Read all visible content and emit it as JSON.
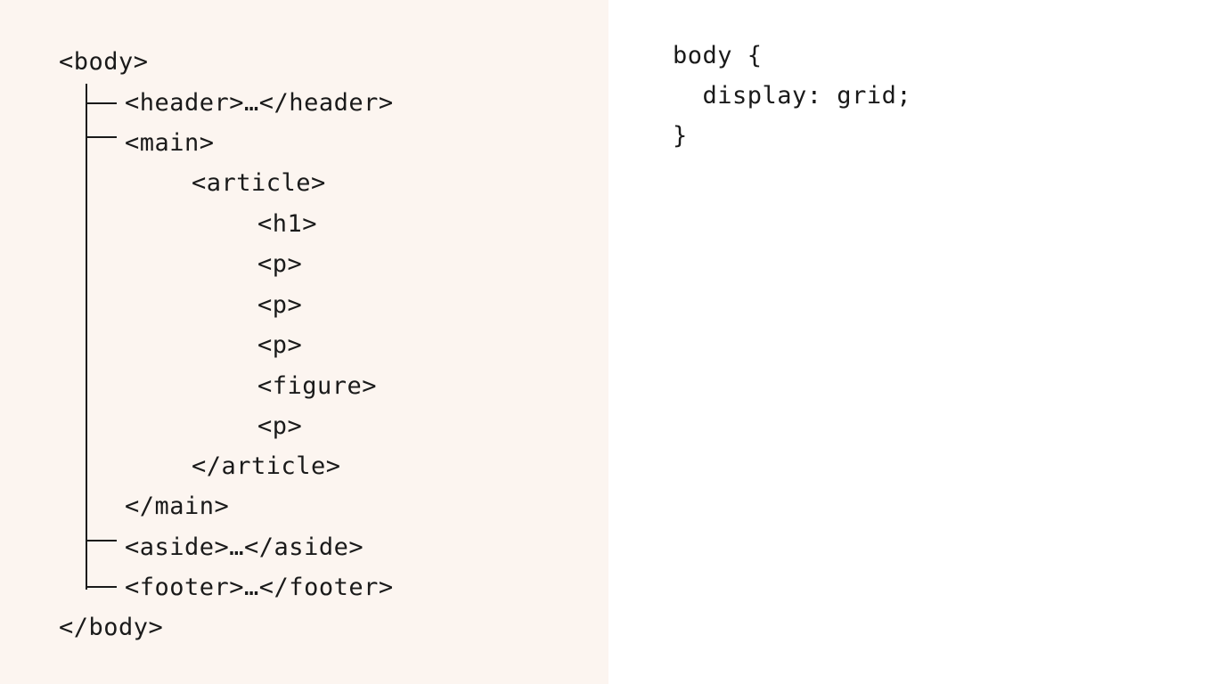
{
  "tree": {
    "lines": [
      "<body>",
      "<header>…</header>",
      "<main>",
      "<article>",
      "<h1>",
      "<p>",
      "<p>",
      "<p>",
      "<figure>",
      "<p>",
      "</article>",
      "</main>",
      "<aside>…</aside>",
      "<footer>…</footer>",
      "</body>"
    ]
  },
  "css": {
    "lines": [
      "body {",
      "  display: grid;",
      "}"
    ]
  }
}
